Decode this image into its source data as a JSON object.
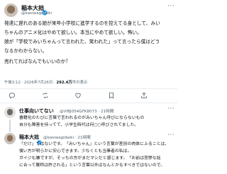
{
  "main_tweet": {
    "name": "稲本大拙",
    "handle": "@kasiwagidaiki",
    "lines": [
      "発達に遅れのある娘が来年小学校に進学するのを控えてる身として、みい",
      "ちゃんのアニメ化はやめて欲しい。本当にやめて欲しい。怖い。",
      "娘が「学校でみいちゃんって言われた、笑われた」って言ったら僕はどう",
      "なるかわからない。",
      "売れてればなんでもいいのか？"
    ],
    "timestamp": "午後3:12 · 2026年7月26日 · ",
    "views_count": "292.4万",
    "views_label": "件の表示"
  },
  "reply1": {
    "name": "仕事向いてない",
    "handle": "@VIBJ054GFK8073 · 21時間",
    "lines": [
      "書籍化のたびに言葉で言われるのがみいちゃん呼びにならないもの",
      "自分も障害を持ってて、小学生時代は何○○呼びされてました。"
    ]
  },
  "reply2": {
    "name": "稲本大拙",
    "handle": "@kasiwagidaiki · 21時間",
    "lines": [
      "「だけ」ではないです。「みいちゃん」という言葉が差別の肉体に上ることは、",
      "僕い方が明らかに安心できます。少なくとも当事者の私は。",
      "ガイジも嫌ですが、そっちの方がまだマシだと感じます。「お前は悲惨な話",
      "に合って蔑称は許される」という言葉以外はなんとかもすべきではないので。"
    ]
  },
  "colors": {
    "accent": "#1d9bf0",
    "text": "#0f1419",
    "muted": "#536471"
  }
}
